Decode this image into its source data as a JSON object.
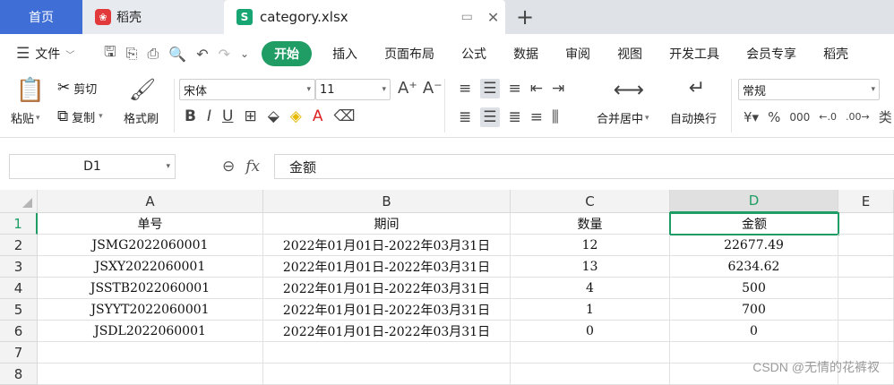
{
  "tabs": {
    "home": "首页",
    "doc": "稻壳",
    "file": "category.xlsx"
  },
  "menubar": {
    "file_label": "文件",
    "items": [
      "开始",
      "插入",
      "页面布局",
      "公式",
      "数据",
      "审阅",
      "视图",
      "开发工具",
      "会员专享",
      "稻壳"
    ]
  },
  "ribbon": {
    "paste": "粘贴",
    "cut": "剪切",
    "copy": "复制",
    "format_painter": "格式刷",
    "font_name": "宋体",
    "font_size": "11",
    "merge_center": "合并居中",
    "wrap_text": "自动换行",
    "number_format": "常规",
    "type_label": "类"
  },
  "formula_bar": {
    "cell_ref": "D1",
    "fx": "fx",
    "value": "金额"
  },
  "sheet": {
    "columns": [
      "A",
      "B",
      "C",
      "D",
      "E"
    ],
    "rows": [
      "1",
      "2",
      "3",
      "4",
      "5",
      "6",
      "7",
      "8"
    ],
    "data": [
      [
        "单号",
        "期间",
        "数量",
        "金额"
      ],
      [
        "JSMG2022060001",
        "2022年01月01日-2022年03月31日",
        "12",
        "22677.49"
      ],
      [
        "JSXY2022060001",
        "2022年01月01日-2022年03月31日",
        "13",
        "6234.62"
      ],
      [
        "JSSTB2022060001",
        "2022年01月01日-2022年03月31日",
        "4",
        "500"
      ],
      [
        "JSYYT2022060001",
        "2022年01月01日-2022年03月31日",
        "1",
        "700"
      ],
      [
        "JSDL2022060001",
        "2022年01月01日-2022年03月31日",
        "0",
        "0"
      ]
    ]
  },
  "watermark": "CSDN @无情的花裤衩",
  "colors": {
    "accent": "#1f9d64",
    "home_tab": "#3f6fd6"
  }
}
